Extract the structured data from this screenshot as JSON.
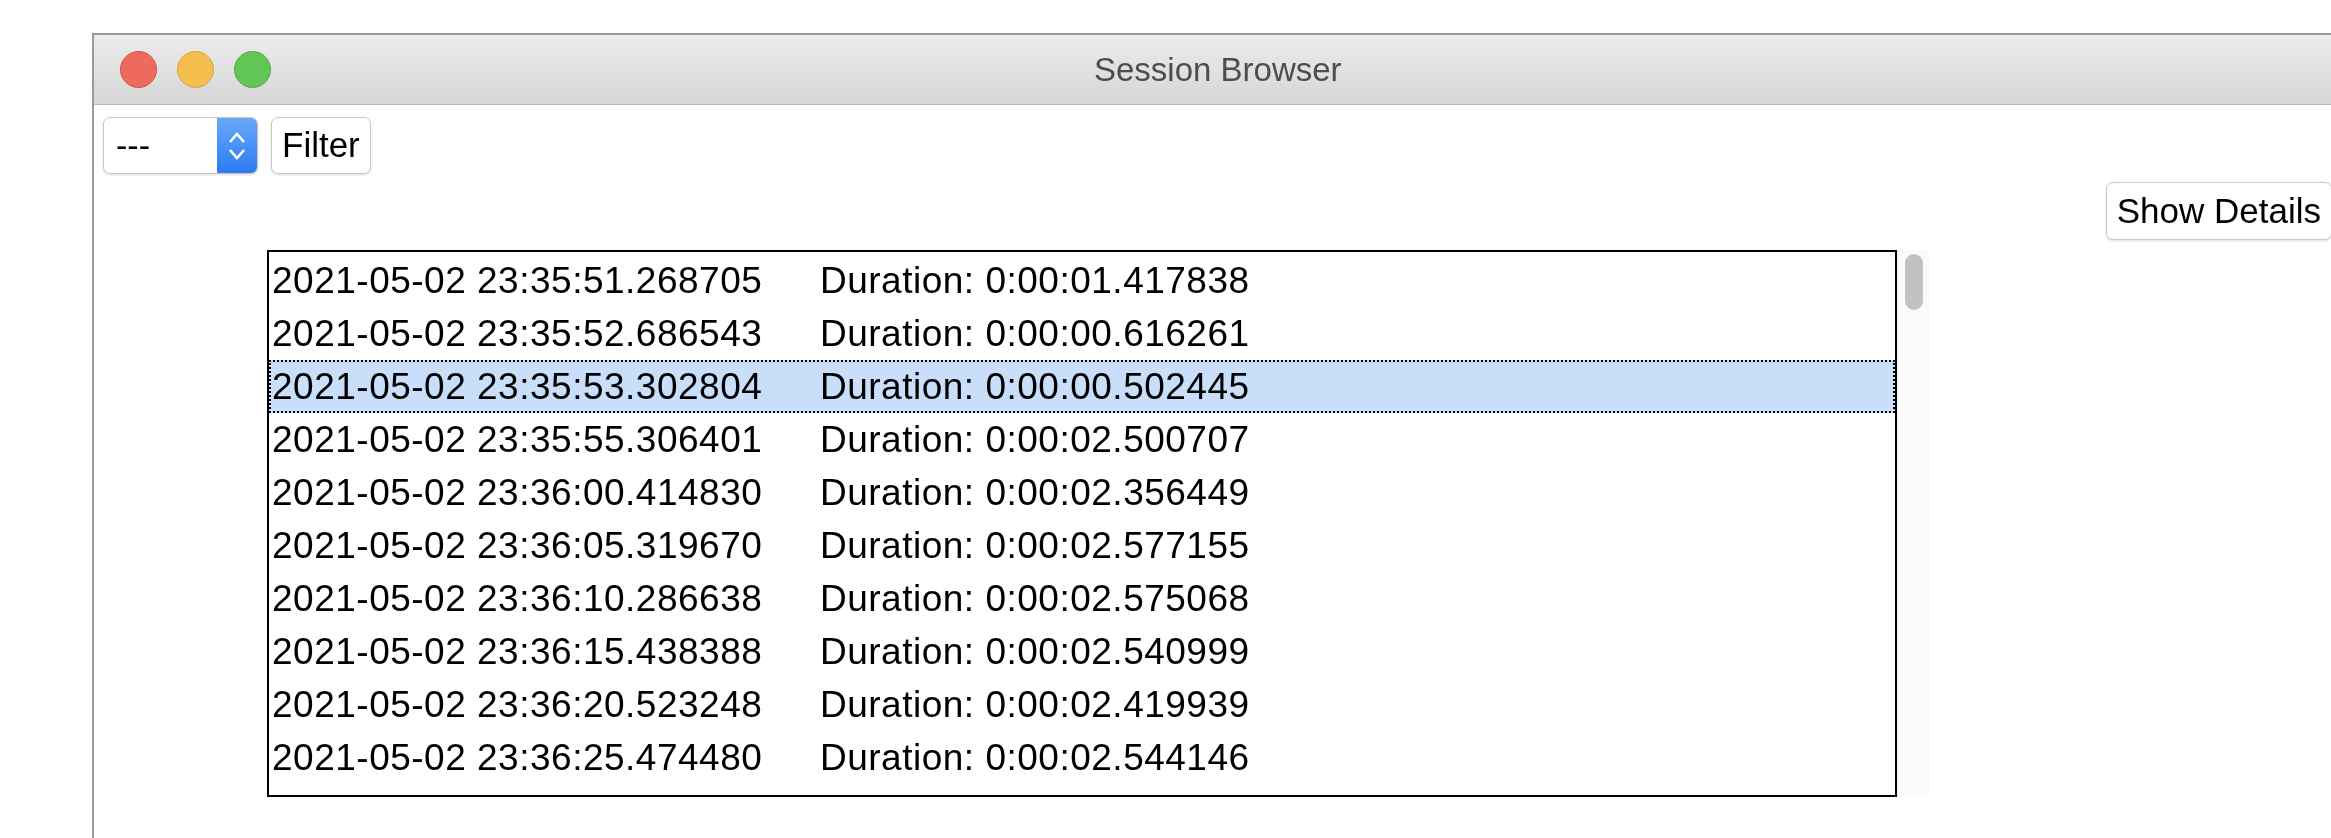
{
  "window": {
    "title": "Session Browser"
  },
  "toolbar": {
    "dropdown": {
      "value": "---"
    },
    "filter_button": "Filter"
  },
  "details_button": "Show Details",
  "sessions": [
    {
      "time": "2021-05-02 23:35:51.268705",
      "duration": "Duration: 0:00:01.417838",
      "selected": false
    },
    {
      "time": "2021-05-02 23:35:52.686543",
      "duration": "Duration: 0:00:00.616261",
      "selected": false
    },
    {
      "time": "2021-05-02 23:35:53.302804",
      "duration": "Duration: 0:00:00.502445",
      "selected": true
    },
    {
      "time": "2021-05-02 23:35:55.306401",
      "duration": "Duration: 0:00:02.500707",
      "selected": false
    },
    {
      "time": "2021-05-02 23:36:00.414830",
      "duration": "Duration: 0:00:02.356449",
      "selected": false
    },
    {
      "time": "2021-05-02 23:36:05.319670",
      "duration": "Duration: 0:00:02.577155",
      "selected": false
    },
    {
      "time": "2021-05-02 23:36:10.286638",
      "duration": "Duration: 0:00:02.575068",
      "selected": false
    },
    {
      "time": "2021-05-02 23:36:15.438388",
      "duration": "Duration: 0:00:02.540999",
      "selected": false
    },
    {
      "time": "2021-05-02 23:36:20.523248",
      "duration": "Duration: 0:00:02.419939",
      "selected": false
    },
    {
      "time": "2021-05-02 23:36:25.474480",
      "duration": "Duration: 0:00:02.544146",
      "selected": false
    }
  ]
}
